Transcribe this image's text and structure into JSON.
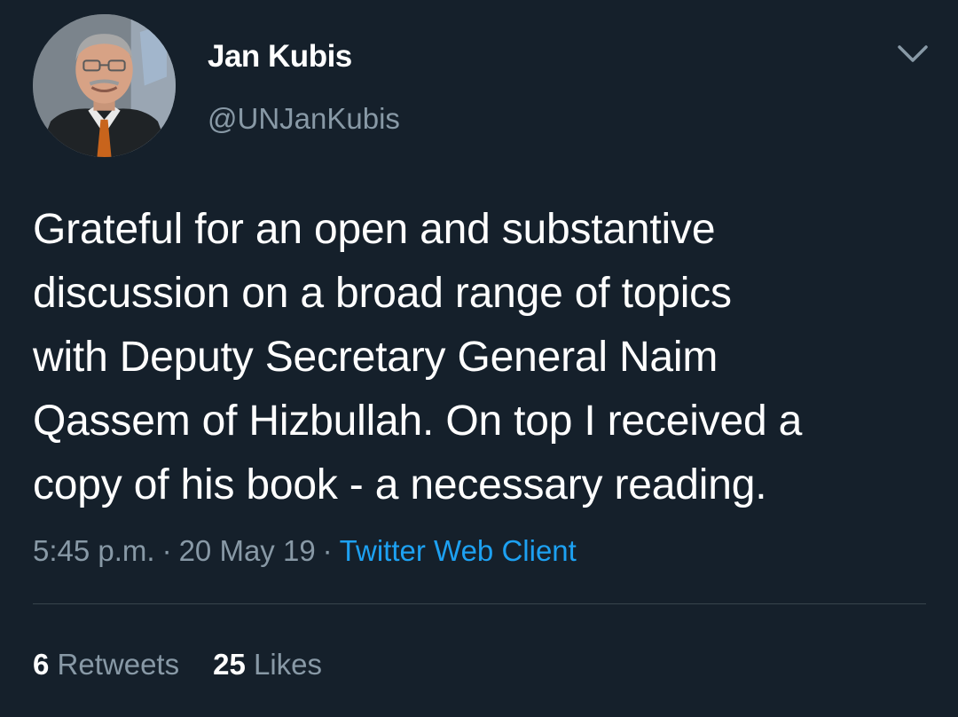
{
  "user": {
    "display_name": "Jan Kubis",
    "handle": "@UNJanKubis"
  },
  "tweet": {
    "text": "Grateful for an open and substantive\ndiscussion on a broad range of topics\nwith Deputy Secretary General Naim\nQassem of Hizbullah. On top I received a\ncopy of his book - a necessary reading.",
    "time": "5:45 p.m.",
    "date": "20 May 19",
    "separator": "·",
    "source": "Twitter Web Client"
  },
  "stats": {
    "retweets_count": "6",
    "retweets_label": "Retweets",
    "likes_count": "25",
    "likes_label": "Likes"
  },
  "icons": {
    "menu": "chevron-down-icon"
  },
  "colors": {
    "background": "#15202b",
    "primary_text": "#ffffff",
    "secondary_text": "#8899a6",
    "link": "#1da1f2",
    "divider": "#38444d"
  }
}
